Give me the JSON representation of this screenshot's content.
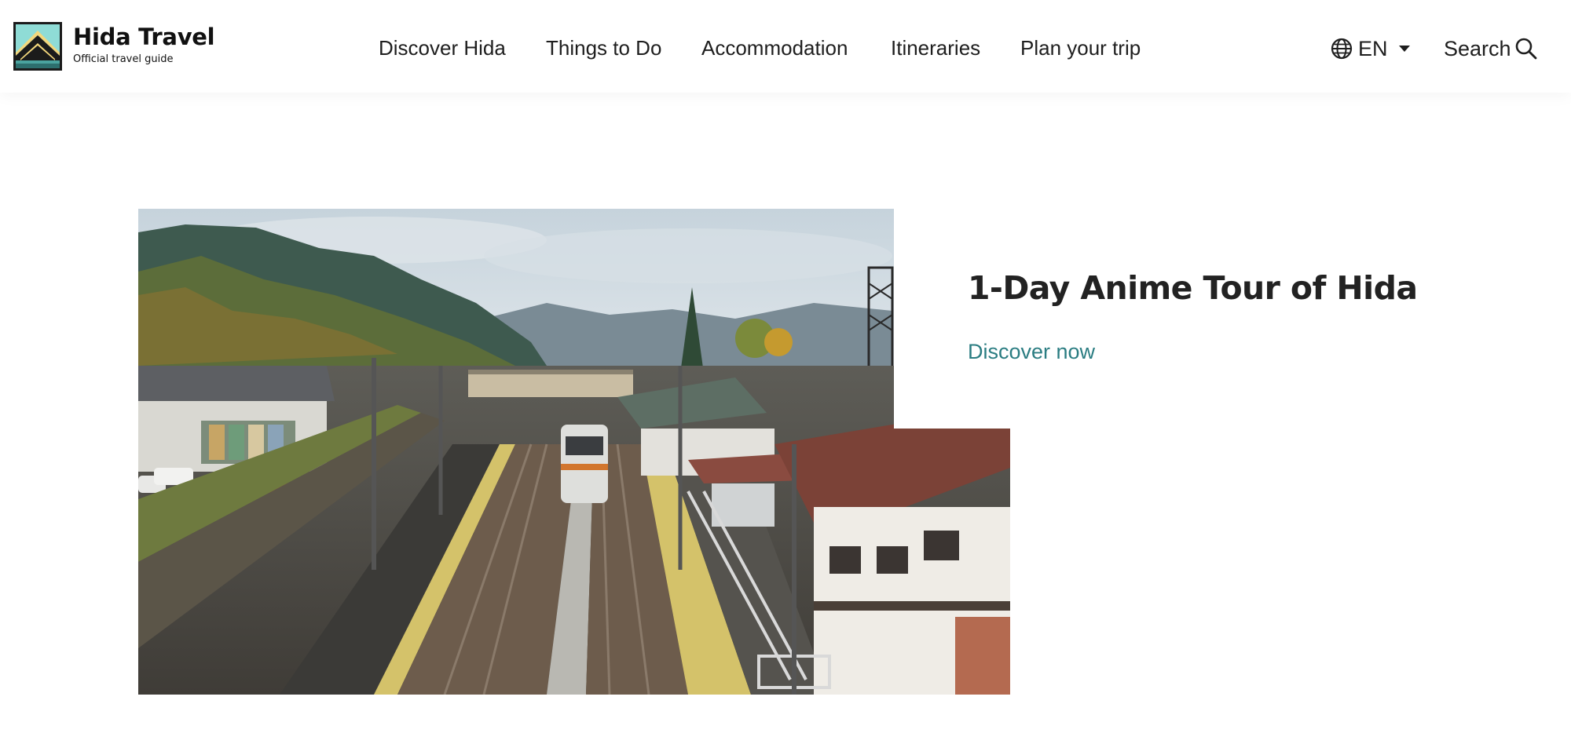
{
  "brand": {
    "name": "Hida Travel",
    "tagline": "Official travel guide",
    "colors": {
      "teal_light": "#7fd6d0",
      "teal_dark": "#1f5b5e",
      "gold": "#f2d27a",
      "accent_link": "#2b7d82"
    }
  },
  "nav": {
    "items": [
      {
        "label": "Discover Hida"
      },
      {
        "label": "Things to Do"
      },
      {
        "label": "Accommodation"
      },
      {
        "label": "Itineraries"
      },
      {
        "label": "Plan your trip"
      }
    ]
  },
  "language": {
    "icon": "globe-icon",
    "selected": "EN",
    "dropdown_icon": "caret-down-icon"
  },
  "search": {
    "label": "Search",
    "icon": "search-icon"
  },
  "feature": {
    "image_description_icon": "railway-station-photo",
    "title": "1-Day Anime Tour of Hida",
    "link_label": "Discover now"
  }
}
